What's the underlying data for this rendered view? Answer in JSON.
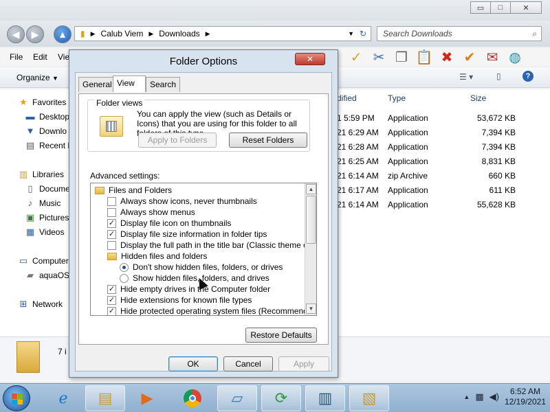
{
  "explorer": {
    "window_buttons": {
      "minimize": "▭",
      "maximize": "□",
      "close": "✕"
    },
    "breadcrumb": [
      "Calub Viem",
      "Downloads"
    ],
    "search_placeholder": "Search Downloads",
    "menu": [
      "File",
      "Edit",
      "Vie"
    ],
    "organize_label": "Organize",
    "nav": {
      "favorites": "Favorites",
      "fav_items": [
        "Desktop",
        "Downlo",
        "Recent P"
      ],
      "libraries": "Libraries",
      "lib_items": [
        "Docume",
        "Music",
        "Pictures",
        "Videos"
      ],
      "computer": "Computer",
      "drive": "aquaOS",
      "network": "Network"
    },
    "columns": {
      "modified": "dified",
      "type": "Type",
      "size": "Size"
    },
    "files": [
      {
        "date": "1 5:59 PM",
        "type": "Application",
        "size": "53,672 KB"
      },
      {
        "date": "21 6:29 AM",
        "type": "Application",
        "size": "7,394 KB"
      },
      {
        "date": "21 6:28 AM",
        "type": "Application",
        "size": "7,394 KB"
      },
      {
        "date": "21 6:25 AM",
        "type": "Application",
        "size": "8,831 KB"
      },
      {
        "date": "21 6:14 AM",
        "type": "zip Archive",
        "size": "660 KB"
      },
      {
        "date": "21 6:17 AM",
        "type": "Application",
        "size": "611 KB"
      },
      {
        "date": "21 6:14 AM",
        "type": "Application",
        "size": "55,628 KB"
      }
    ],
    "status_count": "7 i"
  },
  "dialog": {
    "title": "Folder Options",
    "close": "✕",
    "tabs": [
      "General",
      "View",
      "Search"
    ],
    "active_tab": "View",
    "folder_views": {
      "legend": "Folder views",
      "text": "You can apply the view (such as Details or Icons) that you are using for this folder to all folders of this type.",
      "apply_button": "Apply to Folders",
      "reset_button": "Reset Folders"
    },
    "advanced_label": "Advanced settings:",
    "settings": [
      {
        "kind": "folder",
        "label": "Files and Folders",
        "indent": 0
      },
      {
        "kind": "checkbox",
        "label": "Always show icons, never thumbnails",
        "checked": false,
        "indent": 1
      },
      {
        "kind": "checkbox",
        "label": "Always show menus",
        "checked": false,
        "indent": 1
      },
      {
        "kind": "checkbox",
        "label": "Display file icon on thumbnails",
        "checked": true,
        "indent": 1
      },
      {
        "kind": "checkbox",
        "label": "Display file size information in folder tips",
        "checked": true,
        "indent": 1
      },
      {
        "kind": "checkbox",
        "label": "Display the full path in the title bar (Classic theme only)",
        "checked": false,
        "indent": 1
      },
      {
        "kind": "folder",
        "label": "Hidden files and folders",
        "indent": 1
      },
      {
        "kind": "radio",
        "label": "Don't show hidden files, folders, or drives",
        "checked": true,
        "indent": 2
      },
      {
        "kind": "radio",
        "label": "Show hidden files, folders, and drives",
        "checked": false,
        "indent": 2
      },
      {
        "kind": "checkbox",
        "label": "Hide empty drives in the Computer folder",
        "checked": true,
        "indent": 1
      },
      {
        "kind": "checkbox",
        "label": "Hide extensions for known file types",
        "checked": true,
        "indent": 1
      },
      {
        "kind": "checkbox",
        "label": "Hide protected operating system files (Recommended)",
        "checked": true,
        "indent": 1
      }
    ],
    "restore_defaults": "Restore Defaults",
    "ok": "OK",
    "cancel": "Cancel",
    "apply": "Apply"
  },
  "taskbar": {
    "clock_time": "6:52 AM",
    "clock_date": "12/19/2021"
  }
}
